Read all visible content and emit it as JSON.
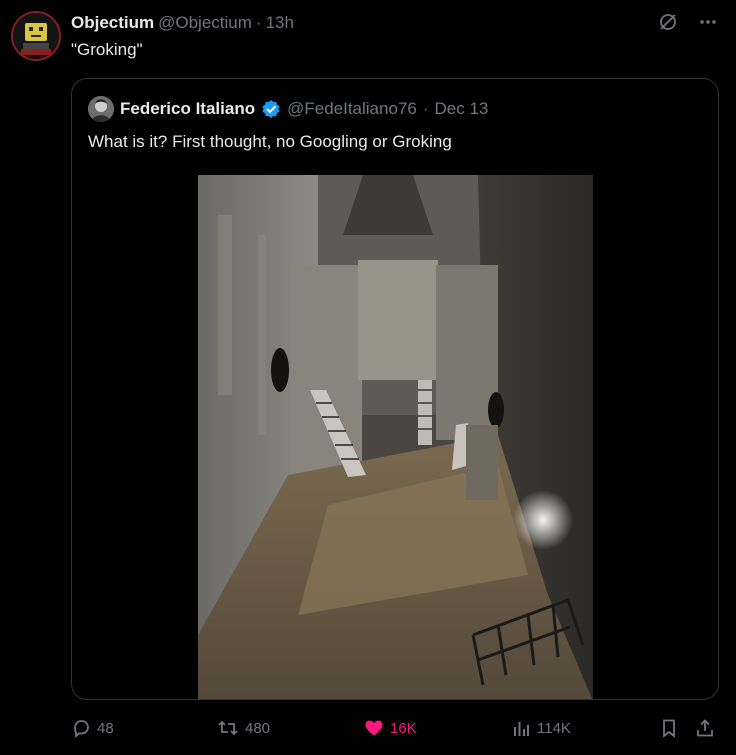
{
  "author": {
    "display_name": "Objectium",
    "handle": "@Objectium",
    "separator": "·",
    "time": "13h"
  },
  "tweet": {
    "text": "\"Groking\""
  },
  "top_actions": {
    "grok_icon": "grok-icon",
    "more_icon": "more-icon"
  },
  "quote": {
    "display_name": "Federico Italiano",
    "verified": true,
    "handle": "@FedeItaliano76",
    "separator": "·",
    "time": "Dec 13",
    "text": "What is it? First thought, no Googling or Groking",
    "media_icon": "photo"
  },
  "actions": {
    "replies": "48",
    "reposts": "480",
    "likes": "16K",
    "views": "114K",
    "bookmark_icon": "bookmark-icon",
    "share_icon": "share-icon"
  },
  "colors": {
    "background": "#000000",
    "text": "#e7e9ea",
    "muted": "#71767b",
    "like": "#f91880",
    "verified": "#1d9bf0",
    "border": "#2f3336"
  }
}
